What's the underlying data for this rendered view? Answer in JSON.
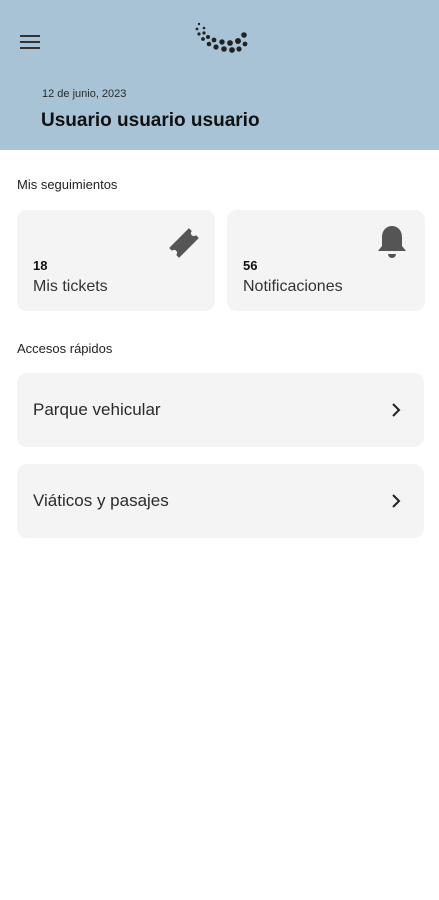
{
  "header": {
    "date": "12 de junio, 2023",
    "user_name": "Usuario usuario usuario",
    "background_color": "#a8c3d6",
    "menu_icon": "hamburger-menu-icon",
    "logo_icon": "dot-spiral-logo"
  },
  "tracking": {
    "title": "Mis seguimientos",
    "cards": [
      {
        "count": "18",
        "label": "Mis tickets",
        "icon": "ticket-icon"
      },
      {
        "count": "56",
        "label": "Notificaciones",
        "icon": "bell-icon"
      }
    ]
  },
  "quick_access": {
    "title": "Accesos rápidos",
    "items": [
      {
        "label": "Parque vehicular",
        "icon": "chevron-right-icon"
      },
      {
        "label": "Viáticos y pasajes",
        "icon": "chevron-right-icon"
      }
    ]
  }
}
